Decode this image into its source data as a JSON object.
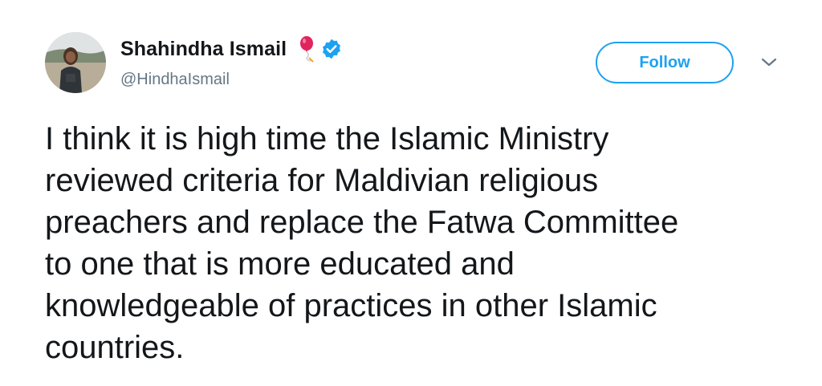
{
  "author": {
    "display_name": "Shahindha Ismail",
    "handle": "@HindhaIsmail",
    "avatar_icon": "profile-photo",
    "name_emoji_icon": "balloon-icon",
    "verified_icon": "verified-badge-icon"
  },
  "actions": {
    "follow_label": "Follow",
    "menu_icon": "chevron-down-icon"
  },
  "tweet": {
    "text": "I think it is high time the Islamic Ministry\nreviewed criteria for Maldivian religious\npreachers and replace the Fatwa Committee\nto one that is more educated and\nknowledgeable of practices in other Islamic\ncountries."
  },
  "colors": {
    "accent": "#1da1f2",
    "text": "#14171a",
    "muted": "#657786",
    "balloon": "#e0245e"
  }
}
